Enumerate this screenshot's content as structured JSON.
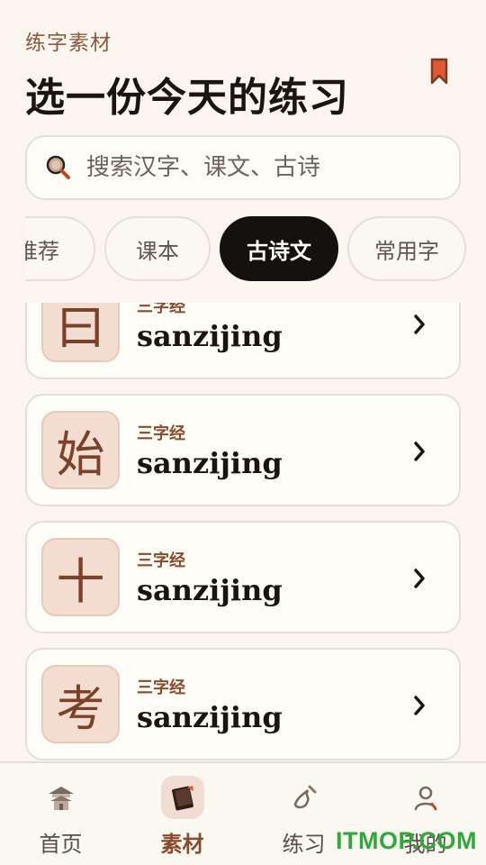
{
  "header": {
    "section_label": "练字素材",
    "title": "选一份今天的练习"
  },
  "search": {
    "placeholder": "搜索汉字、课文、古诗"
  },
  "tabs": [
    {
      "label": "推荐"
    },
    {
      "label": "课本"
    },
    {
      "label": "古诗文",
      "active": true
    },
    {
      "label": "常用字"
    }
  ],
  "cards": [
    {
      "char": "曰",
      "category": "三字经",
      "name": "sanzijing"
    },
    {
      "char": "始",
      "category": "三字经",
      "name": "sanzijing"
    },
    {
      "char": "十",
      "category": "三字经",
      "name": "sanzijing"
    },
    {
      "char": "考",
      "category": "三字经",
      "name": "sanzijing"
    }
  ],
  "nav": [
    {
      "label": "首页",
      "icon": "home-icon"
    },
    {
      "label": "素材",
      "icon": "materials-icon",
      "active": true
    },
    {
      "label": "练习",
      "icon": "practice-icon"
    },
    {
      "label": "我的",
      "icon": "profile-icon"
    }
  ],
  "colors": {
    "background": "#faf6ef",
    "accent": "#8a4a2c",
    "active_tab": "#15110e",
    "char_tile": "#f3ddd1"
  },
  "watermark": "ITMOP.COM"
}
